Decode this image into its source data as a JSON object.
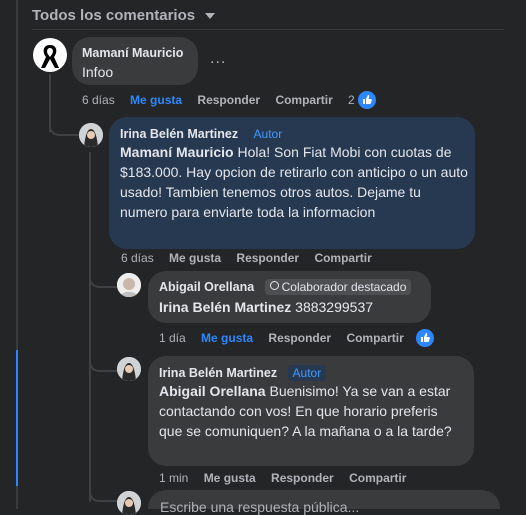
{
  "header": {
    "filter_label": "Todos los comentarios"
  },
  "comments": [
    {
      "author": "Mamaní Mauricio",
      "text": "Infoo",
      "more": "...",
      "time": "6 días",
      "like": "Me gusta",
      "reply": "Responder",
      "share": "Compartir",
      "reactions_count": "2"
    },
    {
      "author": "Irina Belén Martinez",
      "author_badge": "Autor",
      "mention": "Mamaní Mauricio",
      "text": " Hola! Son Fiat Mobi con cuotas de $183.000. Hay opcion de retirarlo con anticipo o un auto usado! Tambien tenemos otros autos. Dejame tu numero para enviarte toda la informacion",
      "time": "6 días",
      "like": "Me gusta",
      "reply": "Responder",
      "share": "Compartir"
    },
    {
      "author": "Abigail Orellana",
      "badge": "Colaborador destacado",
      "mention": "Irina Belén Martinez",
      "text": " 3883299537",
      "time": "1 día",
      "like": "Me gusta",
      "reply": "Responder",
      "share": "Compartir"
    },
    {
      "author": "Irina Belén Martinez",
      "author_badge": "Autor",
      "mention": "Abigail Orellana",
      "text": " Buenisimo! Ya se van a estar contactando con vos! En que horario preferis que se comuniquen? A la mañana o a la tarde?",
      "time": "1 min",
      "like": "Me gusta",
      "reply": "Responder",
      "share": "Compartir"
    }
  ],
  "reply_box": {
    "placeholder": "Escribe una respuesta pública..."
  },
  "colors": {
    "background": "#242526",
    "author_bubble": "#263951",
    "bubble": "#3a3b3c",
    "accent": "#2d88ff"
  }
}
